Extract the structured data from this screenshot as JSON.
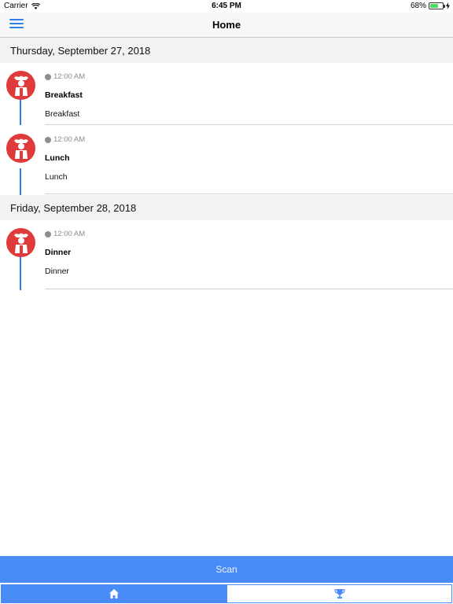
{
  "status_bar": {
    "carrier": "Carrier",
    "time": "6:45 PM",
    "battery_percent_label": "68%",
    "battery_level": 0.68
  },
  "nav": {
    "title": "Home"
  },
  "sections": [
    {
      "date": "Thursday, September 27, 2018",
      "entries": [
        {
          "time": "12:00 AM",
          "title": "Breakfast",
          "description": "Breakfast"
        },
        {
          "time": "12:00 AM",
          "title": "Lunch",
          "description": "Lunch"
        }
      ]
    },
    {
      "date": "Friday, September 28, 2018",
      "entries": [
        {
          "time": "12:00 AM",
          "title": "Dinner",
          "description": "Dinner"
        }
      ]
    }
  ],
  "scan_button": {
    "label": "Scan"
  },
  "tabs": [
    {
      "icon": "home-icon",
      "active": true
    },
    {
      "icon": "trophy-icon",
      "active": false
    }
  ],
  "colors": {
    "accent": "#4a8cf7",
    "timeline": "#2f80ed",
    "avatar_bg": "#e03b3b"
  }
}
